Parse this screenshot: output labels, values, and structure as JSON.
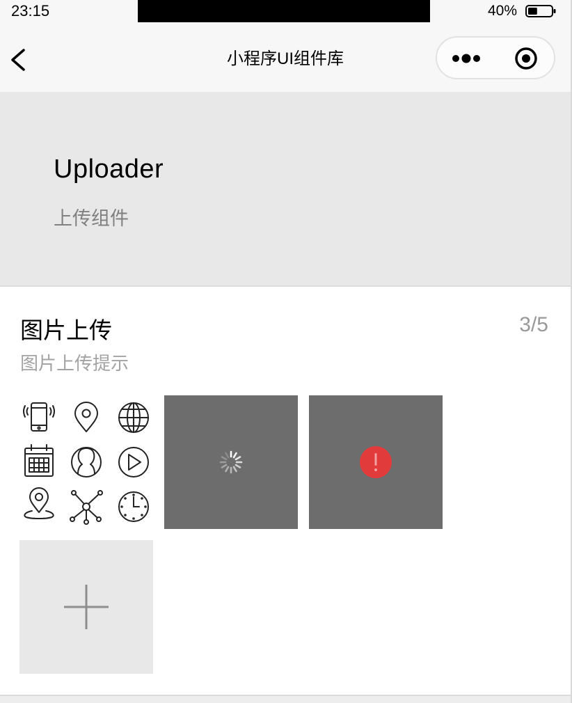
{
  "status_bar": {
    "time": "23:15",
    "battery": "40%",
    "battery_level": 0.4
  },
  "navbar": {
    "title": "小程序UI组件库",
    "back_icon": "chevron-left-icon",
    "more_icon": "more-dots-icon",
    "close_icon": "target-close-icon"
  },
  "header": {
    "title": "Uploader",
    "desc": "上传组件"
  },
  "uploader": {
    "title": "图片上传",
    "count": "3/5",
    "tip": "图片上传提示",
    "files": [
      {
        "status": "done",
        "icon": "icon-collage-image"
      },
      {
        "status": "uploading",
        "icon": "loading-spinner-icon"
      },
      {
        "status": "failed",
        "icon": "error-warning-icon"
      }
    ],
    "add_icon": "plus-icon"
  },
  "colors": {
    "nav_bg": "#f7f7f7",
    "header_bg": "#e8e8e8",
    "file_overlay": "#6d6d6d",
    "error_red": "#e23b3b"
  }
}
